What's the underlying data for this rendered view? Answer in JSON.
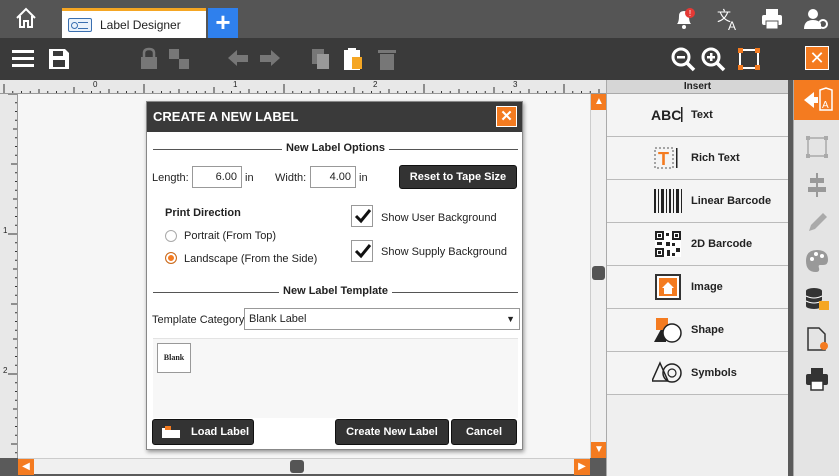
{
  "tab": {
    "title": "Label Designer",
    "add": "+"
  },
  "toolbar": {
    "close": "✕"
  },
  "ruler": {
    "top": [
      "0",
      "1",
      "2",
      "3"
    ],
    "left": [
      "1",
      "2"
    ]
  },
  "insert": {
    "header": "Insert",
    "items": [
      {
        "label": "Text",
        "icon": "abc-text-icon",
        "icon_text": "ABC"
      },
      {
        "label": "Rich Text",
        "icon": "rich-text-icon"
      },
      {
        "label": "Linear Barcode",
        "icon": "linear-barcode-icon"
      },
      {
        "label": "2D Barcode",
        "icon": "qr-code-icon"
      },
      {
        "label": "Image",
        "icon": "image-icon"
      },
      {
        "label": "Shape",
        "icon": "shape-icon"
      },
      {
        "label": "Symbols",
        "icon": "symbols-icon"
      }
    ]
  },
  "dialog": {
    "title": "CREATE A NEW LABEL",
    "close": "✕",
    "options_header": "New Label Options",
    "length_label": "Length:",
    "length_value": "6.00",
    "length_unit": "in",
    "width_label": "Width:",
    "width_value": "4.00",
    "width_unit": "in",
    "reset_button": "Reset to Tape Size",
    "print_direction": "Print Direction",
    "portrait": "Portrait (From Top)",
    "landscape": "Landscape (From the Side)",
    "show_user_bg": "Show User Background",
    "show_supply_bg": "Show Supply Background",
    "template_header": "New Label Template",
    "template_category_label": "Template Category",
    "template_category_value": "Blank Label",
    "template_blank": "Blank",
    "load_button": "Load Label",
    "create_button": "Create New Label",
    "cancel_button": "Cancel"
  },
  "colors": {
    "accent": "#f47b20",
    "tab_add": "#2f80ed",
    "toolbar": "#3a3a3a"
  }
}
